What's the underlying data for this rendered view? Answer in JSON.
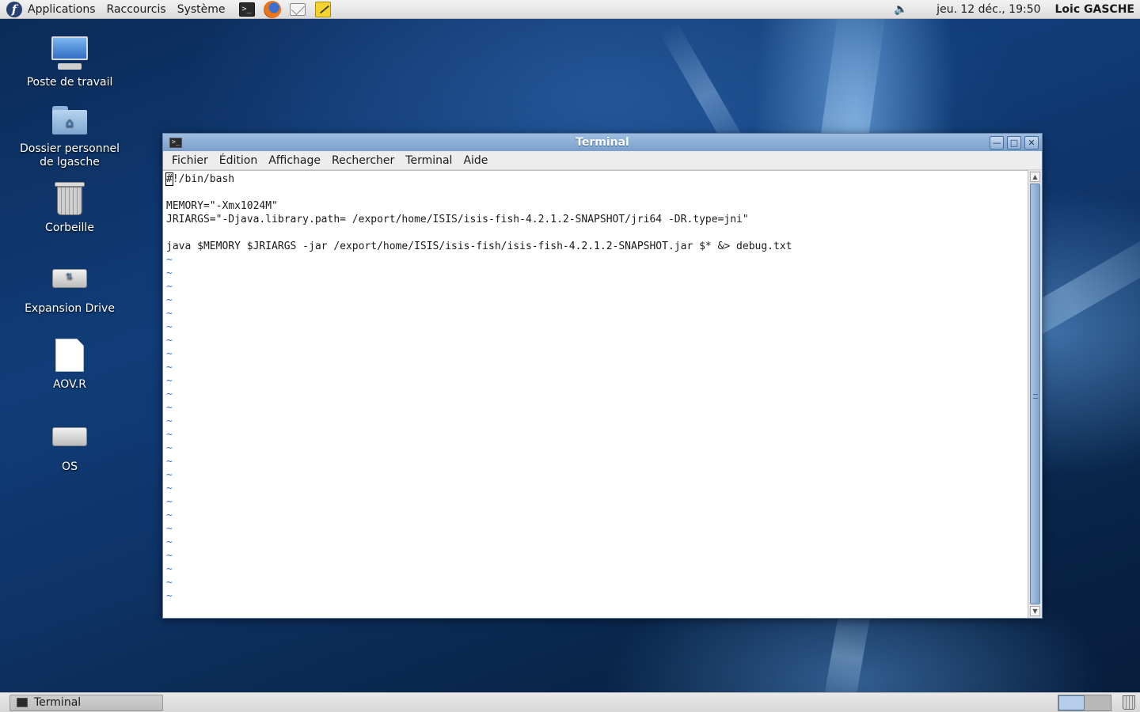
{
  "top_panel": {
    "menus": [
      "Applications",
      "Raccourcis",
      "Système"
    ],
    "launchers": [
      "terminal-icon",
      "firefox-icon",
      "mail-icon",
      "notes-icon"
    ],
    "clock": "jeu. 12 déc., 19:50",
    "user": "Loic GASCHE"
  },
  "desktop": {
    "icons": [
      {
        "label": "Poste de travail",
        "icon": "computer-icon"
      },
      {
        "label_line1": "Dossier personnel",
        "label_line2": "de lgasche",
        "icon": "home-folder-icon"
      },
      {
        "label": "Corbeille",
        "icon": "trash-icon"
      },
      {
        "label": "Expansion Drive",
        "icon": "usb-drive-icon"
      },
      {
        "label": "AOV.R",
        "icon": "file-icon"
      },
      {
        "label": "OS",
        "icon": "disk-icon"
      }
    ]
  },
  "window": {
    "title": "Terminal",
    "menu": [
      "Fichier",
      "Édition",
      "Affichage",
      "Rechercher",
      "Terminal",
      "Aide"
    ],
    "content": {
      "cursor_char": "#",
      "line1_rest": "!/bin/bash",
      "line3": "MEMORY=\"-Xmx1024M\"",
      "line4": "JRIARGS=\"-Djava.library.path= /export/home/ISIS/isis-fish-4.2.1.2-SNAPSHOT/jri64 -DR.type=jni\"",
      "line6": "java $MEMORY $JRIARGS -jar /export/home/ISIS/isis-fish/isis-fish-4.2.1.2-SNAPSHOT.jar $* &> debug.txt",
      "tilde": "~"
    }
  },
  "bottom_panel": {
    "task": "Terminal"
  },
  "colors": {
    "desktop_bg": "#0f3a72",
    "titlebar": "#7aa0cc",
    "vim_tilde": "#3a72c6"
  }
}
